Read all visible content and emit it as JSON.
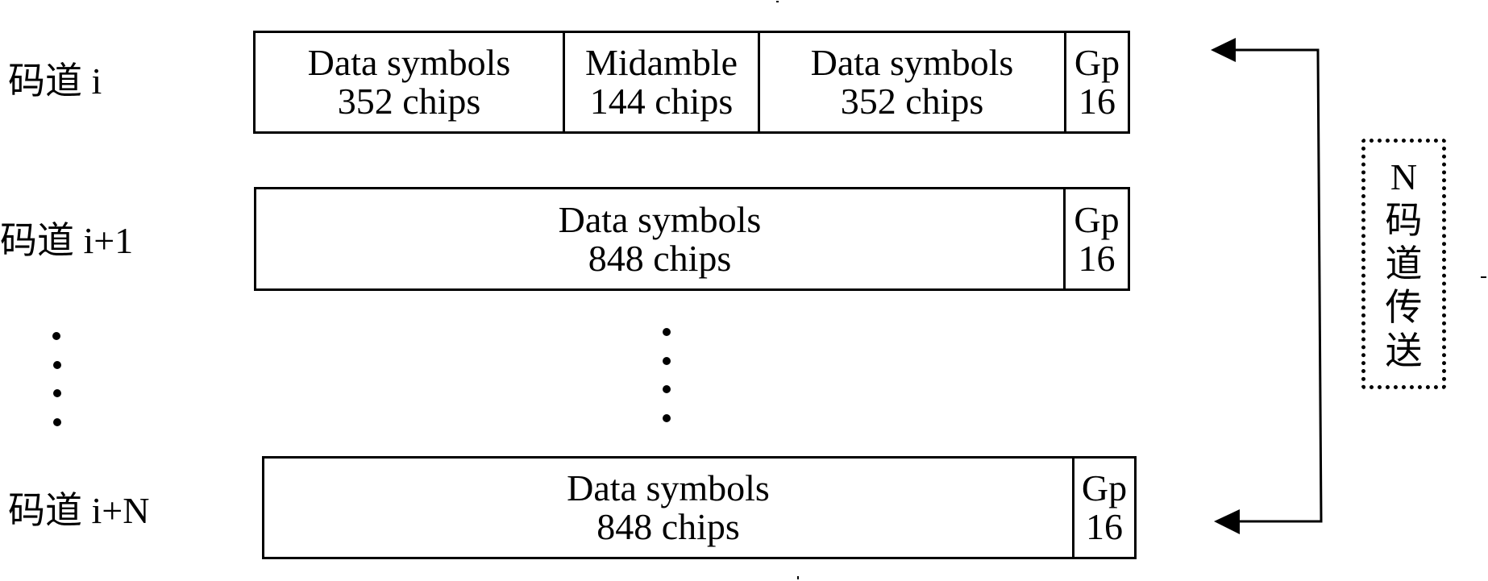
{
  "diagram": {
    "channels": [
      {
        "label": "码道 i",
        "segments": [
          {
            "title": "Data symbols",
            "chips": "352 chips",
            "chip_count": 352
          },
          {
            "title": "Midamble",
            "chips": "144 chips",
            "chip_count": 144
          },
          {
            "title": "Data symbols",
            "chips": "352 chips",
            "chip_count": 352
          },
          {
            "title": "Gp",
            "chips": "16",
            "chip_count": 16
          }
        ]
      },
      {
        "label": "码道 i+1",
        "segments": [
          {
            "title": "Data symbols",
            "chips": "848 chips",
            "chip_count": 848
          },
          {
            "title": "Gp",
            "chips": "16",
            "chip_count": 16
          }
        ]
      },
      {
        "label": "码道 i+N",
        "segments": [
          {
            "title": "Data symbols",
            "chips": "848 chips",
            "chip_count": 848
          },
          {
            "title": "Gp",
            "chips": "16",
            "chip_count": 16
          }
        ]
      }
    ],
    "ellipsis": "⋮",
    "bracket_label": {
      "lines": [
        "N",
        "码",
        "道",
        "传",
        "送"
      ],
      "text": "N码道传送"
    },
    "colors": {
      "ink": "#000000",
      "background": "#ffffff"
    }
  }
}
